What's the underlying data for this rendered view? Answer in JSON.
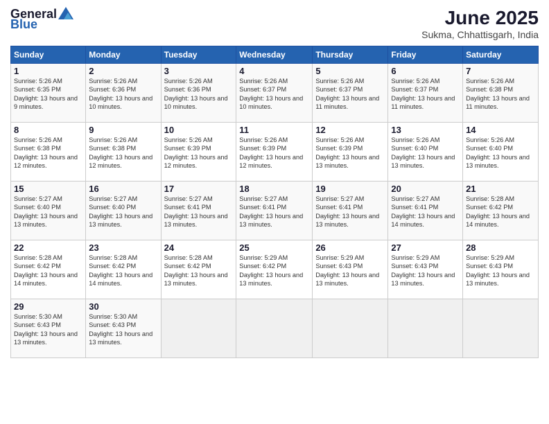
{
  "logo": {
    "general": "General",
    "blue": "Blue"
  },
  "title": {
    "month_year": "June 2025",
    "location": "Sukma, Chhattisgarh, India"
  },
  "days_of_week": [
    "Sunday",
    "Monday",
    "Tuesday",
    "Wednesday",
    "Thursday",
    "Friday",
    "Saturday"
  ],
  "weeks": [
    [
      {
        "day": "1",
        "sunrise": "5:26 AM",
        "sunset": "6:35 PM",
        "daylight": "13 hours and 9 minutes."
      },
      {
        "day": "2",
        "sunrise": "5:26 AM",
        "sunset": "6:36 PM",
        "daylight": "13 hours and 10 minutes."
      },
      {
        "day": "3",
        "sunrise": "5:26 AM",
        "sunset": "6:36 PM",
        "daylight": "13 hours and 10 minutes."
      },
      {
        "day": "4",
        "sunrise": "5:26 AM",
        "sunset": "6:37 PM",
        "daylight": "13 hours and 10 minutes."
      },
      {
        "day": "5",
        "sunrise": "5:26 AM",
        "sunset": "6:37 PM",
        "daylight": "13 hours and 11 minutes."
      },
      {
        "day": "6",
        "sunrise": "5:26 AM",
        "sunset": "6:37 PM",
        "daylight": "13 hours and 11 minutes."
      },
      {
        "day": "7",
        "sunrise": "5:26 AM",
        "sunset": "6:38 PM",
        "daylight": "13 hours and 11 minutes."
      }
    ],
    [
      {
        "day": "8",
        "sunrise": "5:26 AM",
        "sunset": "6:38 PM",
        "daylight": "13 hours and 12 minutes."
      },
      {
        "day": "9",
        "sunrise": "5:26 AM",
        "sunset": "6:38 PM",
        "daylight": "13 hours and 12 minutes."
      },
      {
        "day": "10",
        "sunrise": "5:26 AM",
        "sunset": "6:39 PM",
        "daylight": "13 hours and 12 minutes."
      },
      {
        "day": "11",
        "sunrise": "5:26 AM",
        "sunset": "6:39 PM",
        "daylight": "13 hours and 12 minutes."
      },
      {
        "day": "12",
        "sunrise": "5:26 AM",
        "sunset": "6:39 PM",
        "daylight": "13 hours and 13 minutes."
      },
      {
        "day": "13",
        "sunrise": "5:26 AM",
        "sunset": "6:40 PM",
        "daylight": "13 hours and 13 minutes."
      },
      {
        "day": "14",
        "sunrise": "5:26 AM",
        "sunset": "6:40 PM",
        "daylight": "13 hours and 13 minutes."
      }
    ],
    [
      {
        "day": "15",
        "sunrise": "5:27 AM",
        "sunset": "6:40 PM",
        "daylight": "13 hours and 13 minutes."
      },
      {
        "day": "16",
        "sunrise": "5:27 AM",
        "sunset": "6:40 PM",
        "daylight": "13 hours and 13 minutes."
      },
      {
        "day": "17",
        "sunrise": "5:27 AM",
        "sunset": "6:41 PM",
        "daylight": "13 hours and 13 minutes."
      },
      {
        "day": "18",
        "sunrise": "5:27 AM",
        "sunset": "6:41 PM",
        "daylight": "13 hours and 13 minutes."
      },
      {
        "day": "19",
        "sunrise": "5:27 AM",
        "sunset": "6:41 PM",
        "daylight": "13 hours and 13 minutes."
      },
      {
        "day": "20",
        "sunrise": "5:27 AM",
        "sunset": "6:41 PM",
        "daylight": "13 hours and 14 minutes."
      },
      {
        "day": "21",
        "sunrise": "5:28 AM",
        "sunset": "6:42 PM",
        "daylight": "13 hours and 14 minutes."
      }
    ],
    [
      {
        "day": "22",
        "sunrise": "5:28 AM",
        "sunset": "6:42 PM",
        "daylight": "13 hours and 14 minutes."
      },
      {
        "day": "23",
        "sunrise": "5:28 AM",
        "sunset": "6:42 PM",
        "daylight": "13 hours and 14 minutes."
      },
      {
        "day": "24",
        "sunrise": "5:28 AM",
        "sunset": "6:42 PM",
        "daylight": "13 hours and 13 minutes."
      },
      {
        "day": "25",
        "sunrise": "5:29 AM",
        "sunset": "6:42 PM",
        "daylight": "13 hours and 13 minutes."
      },
      {
        "day": "26",
        "sunrise": "5:29 AM",
        "sunset": "6:43 PM",
        "daylight": "13 hours and 13 minutes."
      },
      {
        "day": "27",
        "sunrise": "5:29 AM",
        "sunset": "6:43 PM",
        "daylight": "13 hours and 13 minutes."
      },
      {
        "day": "28",
        "sunrise": "5:29 AM",
        "sunset": "6:43 PM",
        "daylight": "13 hours and 13 minutes."
      }
    ],
    [
      {
        "day": "29",
        "sunrise": "5:30 AM",
        "sunset": "6:43 PM",
        "daylight": "13 hours and 13 minutes."
      },
      {
        "day": "30",
        "sunrise": "5:30 AM",
        "sunset": "6:43 PM",
        "daylight": "13 hours and 13 minutes."
      },
      null,
      null,
      null,
      null,
      null
    ]
  ]
}
